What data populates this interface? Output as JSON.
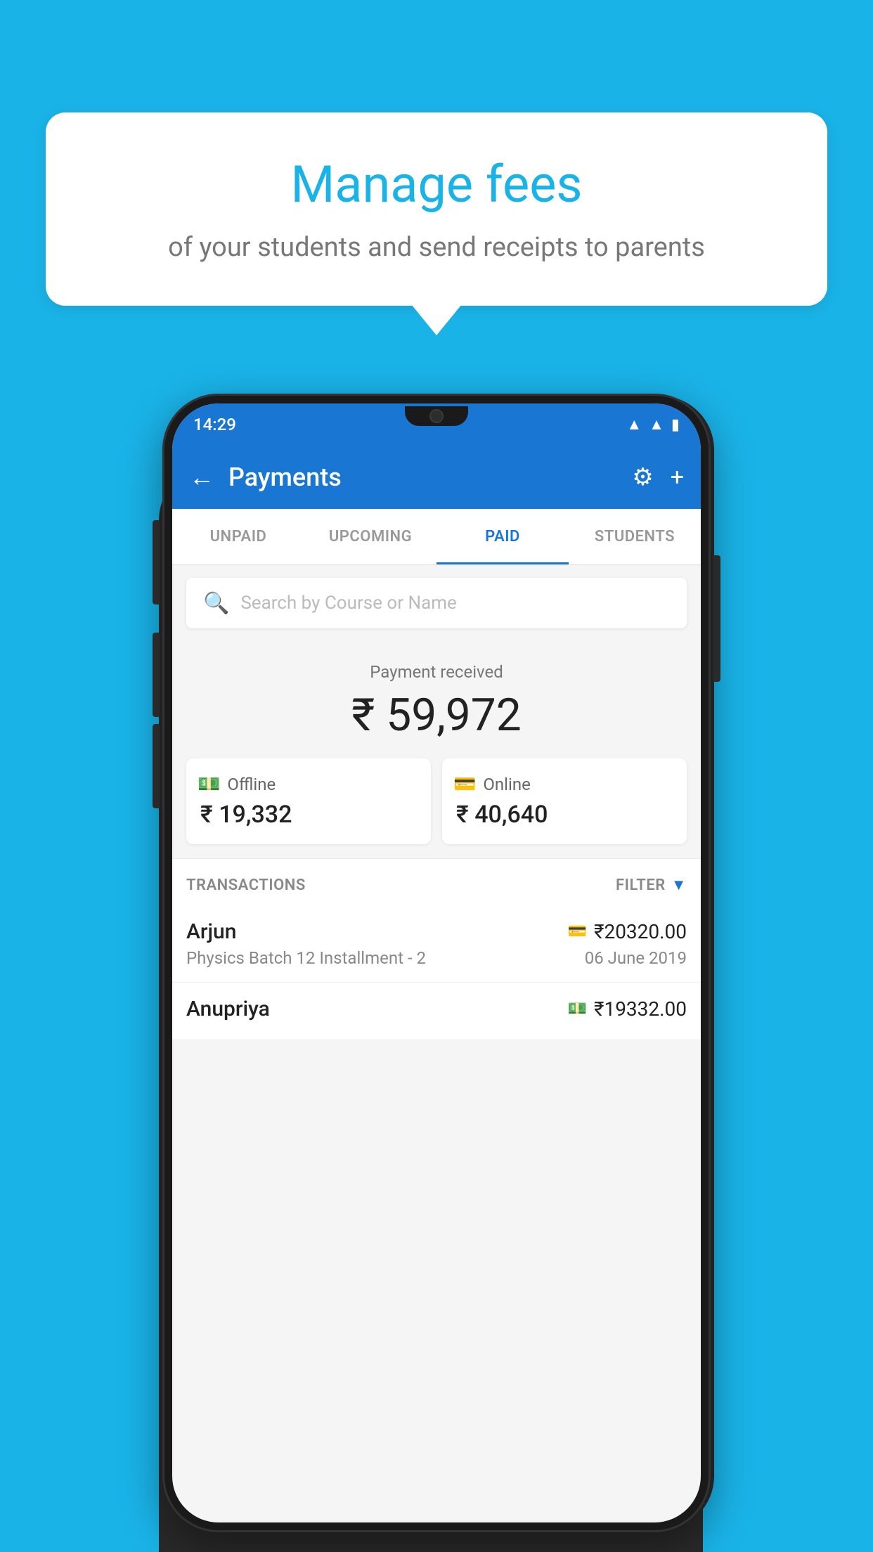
{
  "background": {
    "color": "#1ab3e8"
  },
  "speech_bubble": {
    "title": "Manage fees",
    "subtitle": "of your students and send receipts to parents"
  },
  "status_bar": {
    "time": "14:29",
    "icons": [
      "wifi",
      "signal",
      "battery"
    ]
  },
  "app_bar": {
    "title": "Payments",
    "back_label": "←",
    "gear_label": "⚙",
    "plus_label": "+"
  },
  "tabs": [
    {
      "label": "UNPAID",
      "active": false
    },
    {
      "label": "UPCOMING",
      "active": false
    },
    {
      "label": "PAID",
      "active": true
    },
    {
      "label": "STUDENTS",
      "active": false
    }
  ],
  "search": {
    "placeholder": "Search by Course or Name"
  },
  "payment_summary": {
    "label": "Payment received",
    "amount": "₹ 59,972",
    "offline": {
      "icon": "cash-icon",
      "label": "Offline",
      "amount": "₹ 19,332"
    },
    "online": {
      "icon": "card-icon",
      "label": "Online",
      "amount": "₹ 40,640"
    }
  },
  "transactions": {
    "label": "TRANSACTIONS",
    "filter_label": "FILTER",
    "items": [
      {
        "name": "Arjun",
        "course": "Physics Batch 12 Installment - 2",
        "amount": "₹20320.00",
        "date": "06 June 2019",
        "payment_type": "card"
      },
      {
        "name": "Anupriya",
        "course": "",
        "amount": "₹19332.00",
        "date": "",
        "payment_type": "cash"
      }
    ]
  }
}
